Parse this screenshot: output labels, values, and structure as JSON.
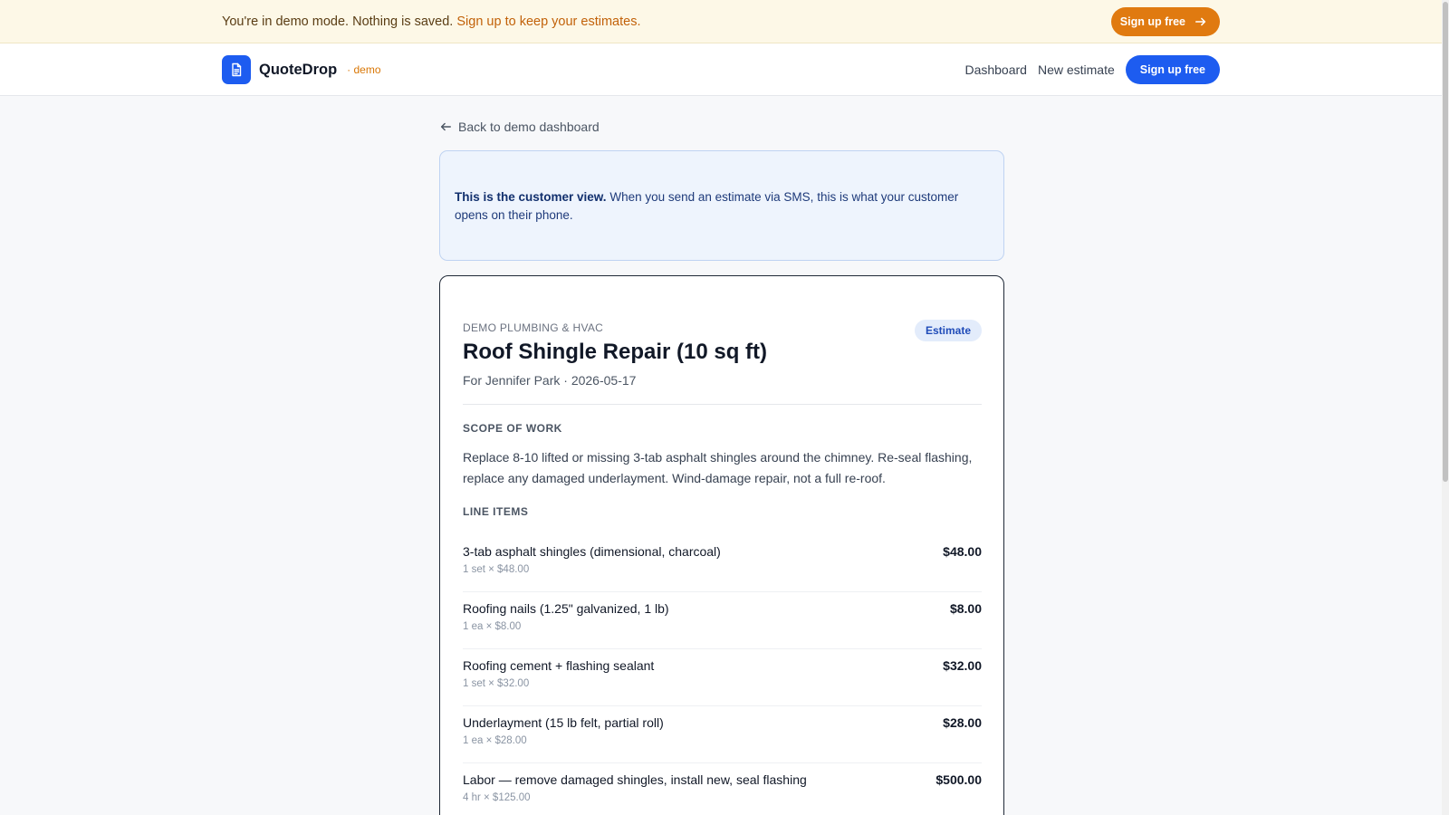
{
  "demo_banner": {
    "text": "You're in demo mode. Nothing is saved.",
    "link_text": "Sign up to keep your estimates.",
    "button_label": "Sign up free"
  },
  "header": {
    "brand_name": "QuoteDrop",
    "brand_suffix": "· demo",
    "nav": {
      "dashboard": "Dashboard",
      "new_estimate": "New estimate",
      "signup": "Sign up free"
    }
  },
  "back_link": "Back to demo dashboard",
  "info_box": {
    "bold": "This is the customer view.",
    "text": "When you send an estimate via SMS, this is what your customer opens on their phone."
  },
  "estimate": {
    "company": "DEMO PLUMBING & HVAC",
    "badge": "Estimate",
    "title": "Roof Shingle Repair (10 sq ft)",
    "meta": "For Jennifer Park · 2026-05-17",
    "scope_label": "SCOPE OF WORK",
    "scope_text": "Replace 8-10 lifted or missing 3-tab asphalt shingles around the chimney. Re-seal flashing, replace any damaged underlayment. Wind-damage repair, not a full re-roof.",
    "line_items_label": "LINE ITEMS",
    "line_items": [
      {
        "name": "3-tab asphalt shingles (dimensional, charcoal)",
        "detail": "1 set × $48.00",
        "price": "$48.00"
      },
      {
        "name": "Roofing nails (1.25\" galvanized, 1 lb)",
        "detail": "1 ea × $8.00",
        "price": "$8.00"
      },
      {
        "name": "Roofing cement + flashing sealant",
        "detail": "1 set × $32.00",
        "price": "$32.00"
      },
      {
        "name": "Underlayment (15 lb felt, partial roll)",
        "detail": "1 ea × $28.00",
        "price": "$28.00"
      },
      {
        "name": "Labor — remove damaged shingles, install new, seal flashing",
        "detail": "4 hr × $125.00",
        "price": "$500.00"
      }
    ]
  },
  "colors": {
    "accent_blue": "#1d5cf0",
    "accent_orange": "#e07a10",
    "banner_bg": "#fdf8e7",
    "info_bg": "#eef4fd"
  }
}
